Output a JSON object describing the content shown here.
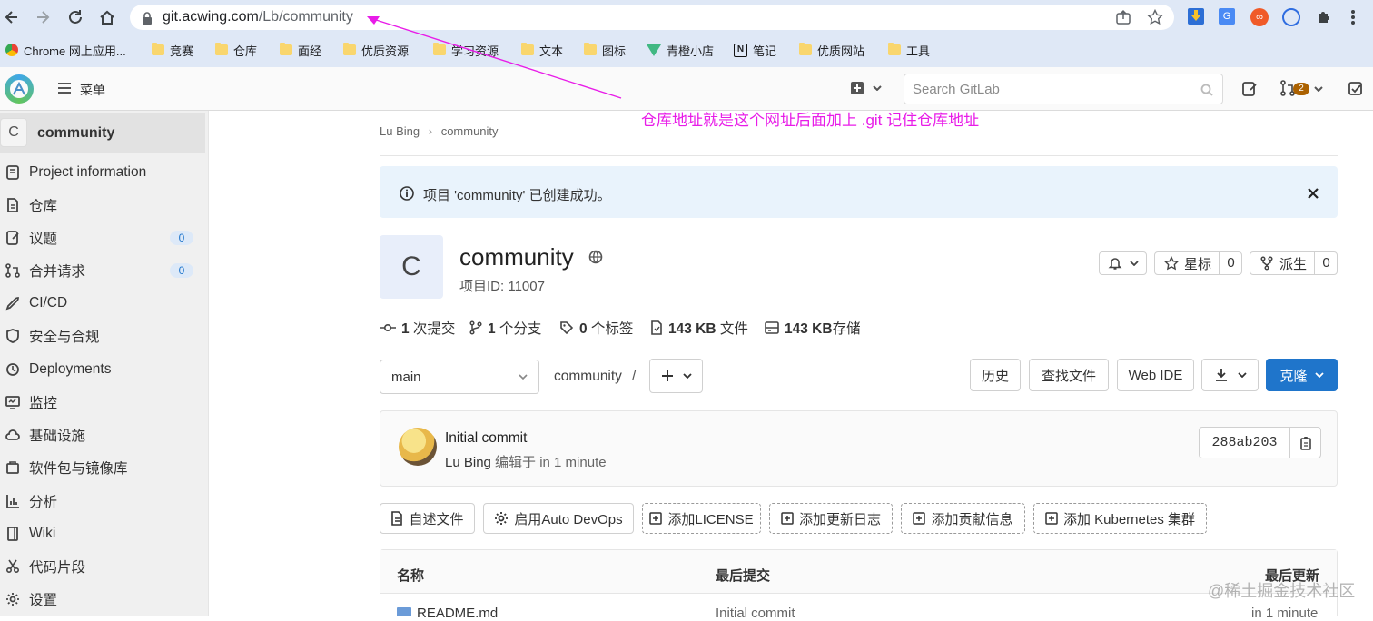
{
  "browser": {
    "url_host": "git.acwing.com",
    "url_path": "/Lb/community",
    "bookmarks": [
      {
        "label": "Chrome 网上应用...",
        "type": "app"
      },
      {
        "label": "竞赛",
        "type": "folder"
      },
      {
        "label": "仓库",
        "type": "folder"
      },
      {
        "label": "面经",
        "type": "folder"
      },
      {
        "label": "优质资源",
        "type": "folder"
      },
      {
        "label": "学习资源",
        "type": "folder"
      },
      {
        "label": "文本",
        "type": "folder"
      },
      {
        "label": "图标",
        "type": "folder"
      },
      {
        "label": "青橙小店",
        "type": "vue"
      },
      {
        "label": "笔记",
        "type": "notion"
      },
      {
        "label": "优质网站",
        "type": "folder"
      },
      {
        "label": "工具",
        "type": "folder"
      }
    ]
  },
  "gitlab_nav": {
    "menu_label": "菜单",
    "search_placeholder": "Search GitLab",
    "mr_count": "2"
  },
  "sidebar": {
    "project_avatar_letter": "C",
    "project_name": "community",
    "items": [
      {
        "label": "Project information",
        "icon": "info-icon"
      },
      {
        "label": "仓库",
        "icon": "doc-icon"
      },
      {
        "label": "议题",
        "icon": "issues-icon",
        "badge": "0"
      },
      {
        "label": "合并请求",
        "icon": "merge-request-icon",
        "badge": "0"
      },
      {
        "label": "CI/CD",
        "icon": "rocket-icon"
      },
      {
        "label": "安全与合规",
        "icon": "shield-icon"
      },
      {
        "label": "Deployments",
        "icon": "deployments-icon"
      },
      {
        "label": "监控",
        "icon": "monitor-icon"
      },
      {
        "label": "基础设施",
        "icon": "cloud-icon"
      },
      {
        "label": "软件包与镜像库",
        "icon": "package-icon"
      },
      {
        "label": "分析",
        "icon": "chart-icon"
      },
      {
        "label": "Wiki",
        "icon": "book-icon"
      },
      {
        "label": "代码片段",
        "icon": "snippet-icon"
      },
      {
        "label": "设置",
        "icon": "gear-icon"
      }
    ]
  },
  "breadcrumb": {
    "owner": "Lu Bing",
    "project": "community"
  },
  "alert": {
    "text": "项目 'community' 已创建成功。"
  },
  "project": {
    "avatar_letter": "C",
    "name": "community",
    "id_label": "项目ID: 11007",
    "star_label": "星标",
    "star_count": "0",
    "fork_label": "派生",
    "fork_count": "0"
  },
  "stats": [
    {
      "bold": "1",
      "text": " 次提交",
      "icon": "commit-icon"
    },
    {
      "bold": "1",
      "text": " 个分支",
      "icon": "branch-icon"
    },
    {
      "bold": "0",
      "text": " 个标签",
      "icon": "tag-icon"
    },
    {
      "bold": "143 KB",
      "text": " 文件",
      "icon": "file-icon"
    },
    {
      "bold": "143 KB",
      "text": "存储",
      "icon": "storage-icon"
    }
  ],
  "repo_toolbar": {
    "branch": "main",
    "path": "community",
    "path_sep": "/",
    "history": "历史",
    "find_file": "查找文件",
    "web_ide": "Web IDE",
    "clone": "克隆"
  },
  "commit": {
    "title": "Initial commit",
    "author": "Lu Bing",
    "meta": " 编辑于 in 1 minute",
    "sha": "288ab203"
  },
  "quick_actions": [
    {
      "label": "自述文件",
      "icon": "doc-icon",
      "dashed": false
    },
    {
      "label": "启用Auto DevOps",
      "icon": "gear-icon",
      "dashed": false
    },
    {
      "label": "添加LICENSE",
      "icon": "plus-square-icon",
      "dashed": true
    },
    {
      "label": "添加更新日志",
      "icon": "plus-square-icon",
      "dashed": true
    },
    {
      "label": "添加贡献信息",
      "icon": "plus-square-icon",
      "dashed": true
    },
    {
      "label": "添加 Kubernetes 集群",
      "icon": "plus-square-icon",
      "dashed": true
    }
  ],
  "file_table": {
    "headers": [
      "名称",
      "最后提交",
      "最后更新"
    ],
    "rows": [
      {
        "name": "README.md",
        "commit": "Initial commit",
        "updated": "in 1 minute"
      }
    ]
  },
  "annotation": {
    "text": "仓库地址就是这个网址后面加上   .git   记住仓库地址"
  },
  "watermark": "@稀土掘金技术社区",
  "colors": {
    "accent": "#1f75cb",
    "annotation": "#e81ce8",
    "alert_bg": "#e9f3fc"
  }
}
